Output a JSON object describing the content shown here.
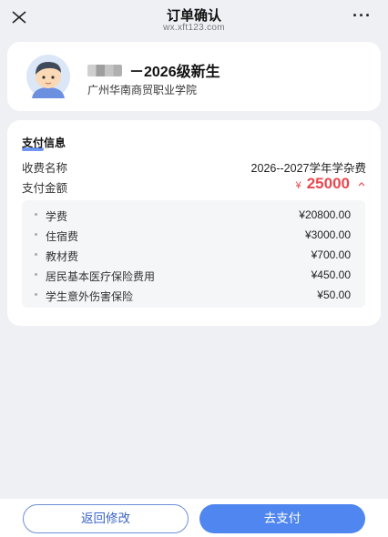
{
  "header": {
    "title": "订单确认",
    "url": "wx.xft123.com",
    "more_label": "···"
  },
  "profile": {
    "name_suffix": "－2026级新生",
    "school": "广州华南商贸职业学院"
  },
  "payment": {
    "section_title": "支付信息",
    "fee_name_label": "收费名称",
    "fee_name_value": "2026--2027学年学杂费",
    "amount_label": "支付金额",
    "currency": "¥",
    "amount_value": "25000",
    "items": [
      {
        "label": "学费",
        "value": "¥20800.00"
      },
      {
        "label": "住宿费",
        "value": "¥3000.00"
      },
      {
        "label": "教材费",
        "value": "¥700.00"
      },
      {
        "label": "居民基本医疗保险费用",
        "value": "¥450.00"
      },
      {
        "label": "学生意外伤害保险",
        "value": "¥50.00"
      }
    ]
  },
  "actions": {
    "back_label": "返回修改",
    "pay_label": "去支付"
  },
  "colors": {
    "accent": "#4f86ef",
    "amount": "#e8484f",
    "background": "#eef0f4"
  }
}
